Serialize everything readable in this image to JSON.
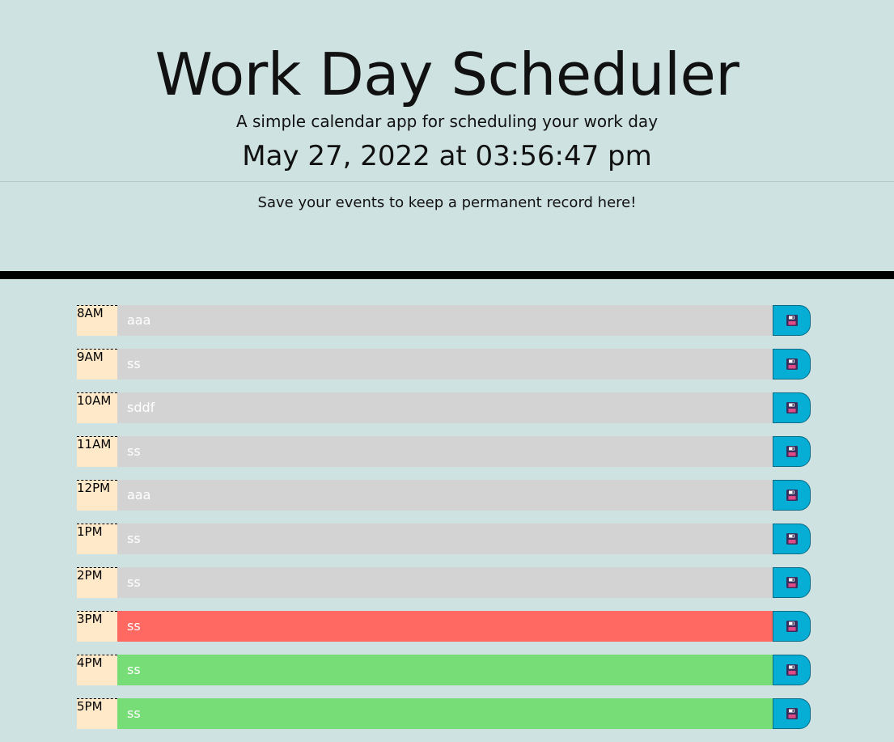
{
  "header": {
    "title": "Work Day Scheduler",
    "subtitle": "A simple calendar app for scheduling your work day",
    "datetime": "May 27, 2022 at 03:56:47 pm",
    "note": "Save your events to keep a permanent record here!"
  },
  "colors": {
    "background": "#cfe2e2",
    "past": "#d3d3d3",
    "present": "#ff6961",
    "future": "#77dd77",
    "hour_bg": "#ffe9c9",
    "save_button": "#06aed5"
  },
  "save_icon": "floppy-disk-icon",
  "rows": [
    {
      "hour": "8AM",
      "text": "aaa",
      "state": "past"
    },
    {
      "hour": "9AM",
      "text": "ss",
      "state": "past"
    },
    {
      "hour": "10AM",
      "text": "sddf",
      "state": "past"
    },
    {
      "hour": "11AM",
      "text": "ss",
      "state": "past"
    },
    {
      "hour": "12PM",
      "text": "aaa",
      "state": "past"
    },
    {
      "hour": "1PM",
      "text": "ss",
      "state": "past"
    },
    {
      "hour": "2PM",
      "text": "ss",
      "state": "past"
    },
    {
      "hour": "3PM",
      "text": "ss",
      "state": "present"
    },
    {
      "hour": "4PM",
      "text": "ss",
      "state": "future"
    },
    {
      "hour": "5PM",
      "text": "ss",
      "state": "future"
    }
  ]
}
